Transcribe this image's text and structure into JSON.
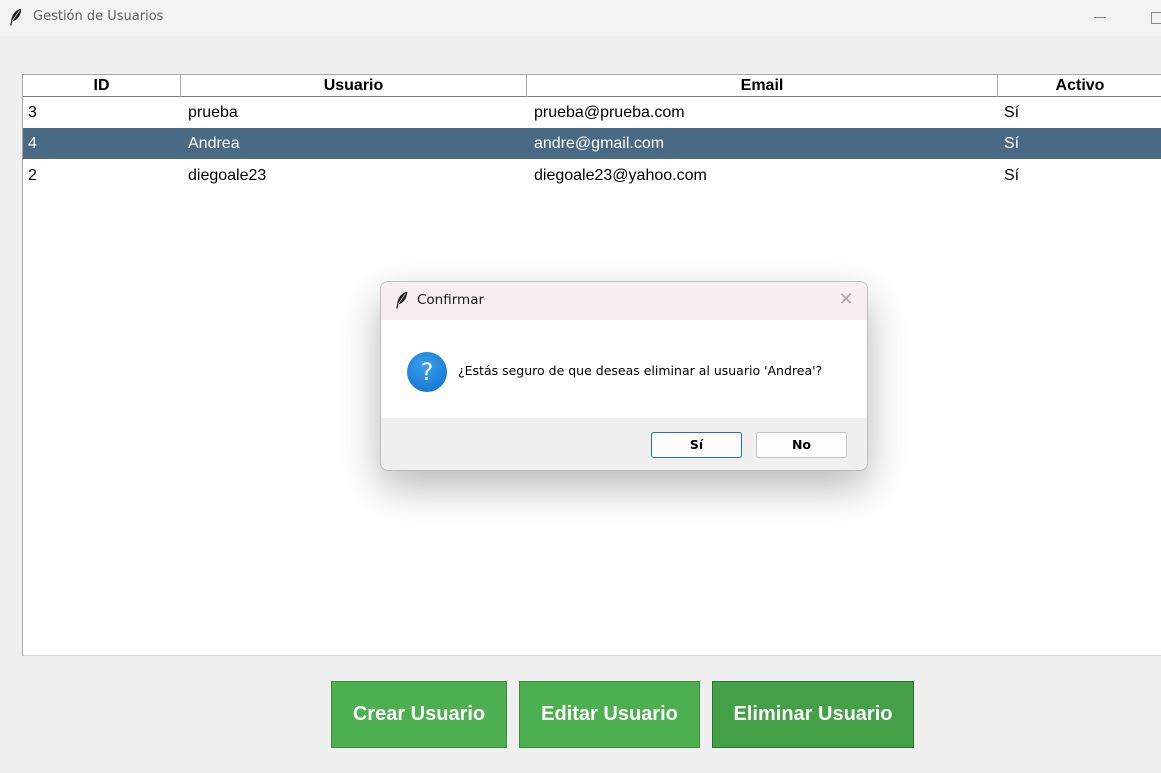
{
  "window": {
    "title": "Gestión de Usuarios"
  },
  "table": {
    "columns": [
      "ID",
      "Usuario",
      "Email",
      "Activo"
    ],
    "rows": [
      {
        "id": "3",
        "usuario": "prueba",
        "email": "prueba@prueba.com",
        "activo": "Sí"
      },
      {
        "id": "4",
        "usuario": "Andrea",
        "email": "andre@gmail.com",
        "activo": "Sí"
      },
      {
        "id": "2",
        "usuario": "diegoale23",
        "email": "diegoale23@yahoo.com",
        "activo": "Sí"
      }
    ],
    "selected_row_id": "4"
  },
  "buttons": {
    "create": "Crear Usuario",
    "edit": "Editar Usuario",
    "delete": "Eliminar Usuario"
  },
  "dialog": {
    "title": "Confirmar",
    "message": "¿Estás seguro de que deseas eliminar al usuario 'Andrea'?",
    "yes_label": "Sí",
    "no_label": "No",
    "icon": "question-icon",
    "close_glyph": "✕"
  },
  "colors": {
    "selection": "#4a6984",
    "button_green": "#4caf50",
    "question_blue": "#0e6cc7"
  }
}
